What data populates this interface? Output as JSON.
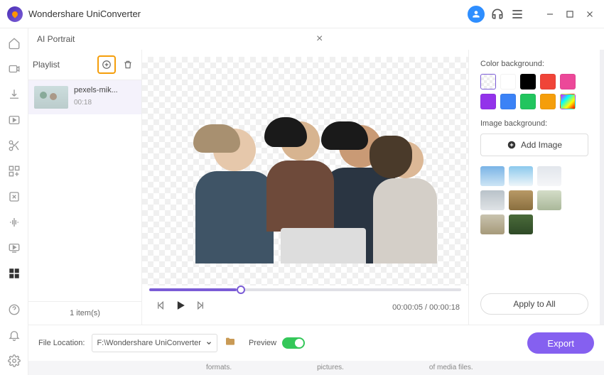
{
  "app": {
    "title": "Wondershare UniConverter"
  },
  "panel": {
    "title": "AI Portrait"
  },
  "playlist": {
    "label": "Playlist",
    "item": {
      "name": "pexels-mik...",
      "duration": "00:18"
    },
    "count": "1 item(s)"
  },
  "playback": {
    "current": "00:00:05",
    "total": "00:00:18"
  },
  "rightPanel": {
    "colorLabel": "Color background:",
    "imageLabel": "Image background:",
    "addImage": "Add Image",
    "applyAll": "Apply to All",
    "colors": [
      "transparent",
      "#ffffff",
      "#000000",
      "#f04438",
      "#ec4899",
      "#9333ea",
      "#3b82f6",
      "#22c55e",
      "#f59e0b",
      "rainbow"
    ],
    "bgThumbs": [
      "linear-gradient(#7ab4e6,#cde5f5)",
      "linear-gradient(#8cc9ed,#eef5f9)",
      "linear-gradient(#e2e6ec,#f5f6f8)",
      "linear-gradient(#b9c2c9,#dfe3e6)",
      "linear-gradient(#b89966,#8a6f3f)",
      "linear-gradient(#d4ddc8,#aab89a)",
      "linear-gradient(#c9c3af,#a69a7a)",
      "linear-gradient(#4a6b3a,#2f4a27)"
    ]
  },
  "footer": {
    "locationLabel": "File Location:",
    "path": "F:\\Wondershare UniConverter",
    "previewLabel": "Preview",
    "export": "Export"
  },
  "bottomStrip": {
    "a": "formats.",
    "b": "pictures.",
    "c": "of media files."
  }
}
